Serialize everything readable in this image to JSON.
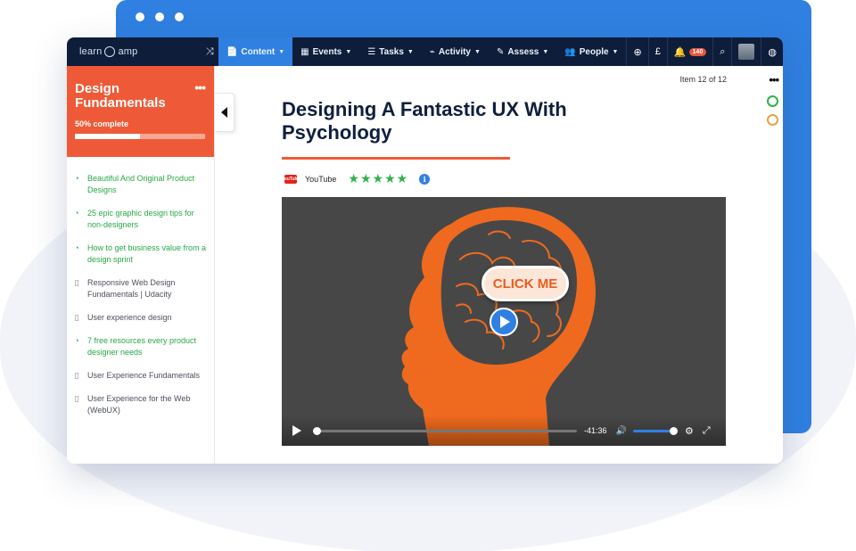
{
  "app": {
    "logo_left": "learn",
    "logo_right": "amp",
    "nav": [
      {
        "icon": "📄",
        "label": "Content",
        "active": true
      },
      {
        "icon": "▦",
        "label": "Events"
      },
      {
        "icon": "☰",
        "label": "Tasks"
      },
      {
        "icon": "⌁",
        "label": "Activity"
      },
      {
        "icon": "✎",
        "label": "Assess"
      },
      {
        "icon": "👥",
        "label": "People"
      }
    ],
    "nav_right": {
      "currency": "£",
      "notifications_count": "140"
    }
  },
  "sidebar": {
    "course_title": "Design Fundamentals",
    "progress_label": "50% complete",
    "progress_fraction": 0.5,
    "items": [
      {
        "type": "rss",
        "status": "done",
        "label": "Beautiful And Original Product Designs"
      },
      {
        "type": "rss",
        "status": "done",
        "label": "25 epic graphic design tips for non-designers"
      },
      {
        "type": "rss",
        "status": "done",
        "label": "How to get business value from a design sprint"
      },
      {
        "type": "bookmark",
        "status": "todo",
        "label": "Responsive Web Design Fundamentals | Udacity"
      },
      {
        "type": "bookmark",
        "status": "todo",
        "label": "User experience design"
      },
      {
        "type": "rss",
        "status": "done",
        "label": "7 free resources every product designer needs"
      },
      {
        "type": "bookmark",
        "status": "todo",
        "label": "User Experience Fundamentals"
      },
      {
        "type": "bookmark",
        "status": "todo",
        "label": "User Experience for the Web (WebUX)"
      }
    ]
  },
  "main": {
    "item_counter": "Item 12 of 12",
    "title": "Designing A Fantastic UX With Psychology",
    "source_logo": "YouTube",
    "source": "YouTube",
    "rating": 5,
    "video": {
      "overlay_button": "CLICK ME",
      "time_remaining": "-41:36",
      "progress_fraction": 0.0,
      "volume_fraction": 1.0
    }
  },
  "colors": {
    "nav_bg": "#0d1d3a",
    "accent_blue": "#2f80e1",
    "course_orange": "#ee5a37",
    "done_green": "#26a944",
    "head_orange": "#ef6a1e"
  }
}
